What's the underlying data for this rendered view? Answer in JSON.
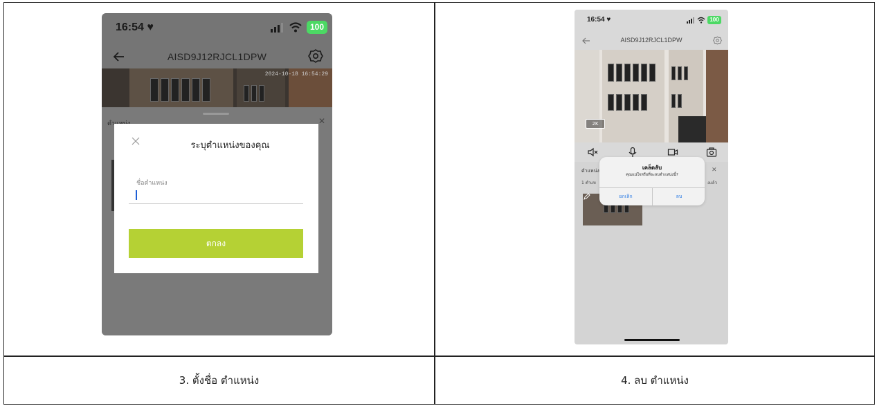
{
  "captions": {
    "left": "3. ตั้งชื่อ ตำแหน่ง",
    "right": "4. ลบ ตำแหน่ง"
  },
  "phone1": {
    "status": {
      "time": "16:54 ♥",
      "battery": "100"
    },
    "nav": {
      "title": "AISD9J12RJCL1DPW"
    },
    "video": {
      "timestamp": "2024-10-18 16:54:29"
    },
    "sheet": {
      "title": "ตำแหน่ง"
    },
    "dialog": {
      "title": "ระบุตำแหน่งของคุณ",
      "field_label": "ชื่อตำแหน่ง",
      "field_value": "",
      "ok_label": "ตกลง"
    }
  },
  "phone2": {
    "status": {
      "time": "16:54 ♥",
      "battery": "100"
    },
    "nav": {
      "title": "AISD9J12RJCL1DPW"
    },
    "video": {
      "resolution": "2K"
    },
    "sheet": {
      "title": "ตำแหน่ง",
      "count_left": "1 ตำแห",
      "count_right": "งแล้ว"
    },
    "alert": {
      "title": "เคล็ดลับ",
      "message": "คุณแน่ใจหรือที่จะลบตำแหน่งนี้?",
      "cancel_label": "ยกเลิก",
      "delete_label": "ลบ"
    }
  },
  "colors": {
    "ok_button": "#b5d134",
    "battery": "#4cd964",
    "alert_button_text": "#2a7ae4"
  },
  "icons": [
    "back-arrow-icon",
    "gear-icon",
    "signal-icon",
    "wifi-icon",
    "close-icon",
    "mute-icon",
    "mic-icon",
    "record-icon",
    "camera-icon",
    "pencil-icon"
  ]
}
